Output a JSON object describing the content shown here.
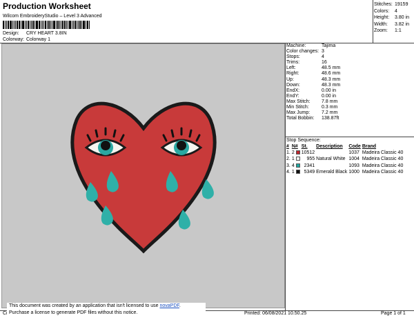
{
  "header": {
    "title": "Production Worksheet",
    "subtitle": "Wilcom EmbroideryStudio – Level 3 Advanced"
  },
  "meta": {
    "design_label": "Design:",
    "design_value": "CRY HEART 3.8IN",
    "colorway_label": "Colorway:",
    "colorway_value": "Colorway 1"
  },
  "summary": {
    "stitches_label": "Stitches:",
    "stitches_value": "19159",
    "colors_label": "Colors:",
    "colors_value": "4",
    "height_label": "Height:",
    "height_value": "3.80 in",
    "width_label": "Width:",
    "width_value": "3.82 in",
    "zoom_label": "Zoom:",
    "zoom_value": "1:1"
  },
  "specs": [
    {
      "label": "Machine:",
      "value": "Tajima"
    },
    {
      "label": "Color changes:",
      "value": "3"
    },
    {
      "label": "Stops:",
      "value": "4"
    },
    {
      "label": "Trims:",
      "value": "16"
    },
    {
      "label": "Left:",
      "value": "48.5 mm"
    },
    {
      "label": "Right:",
      "value": "48.6 mm"
    },
    {
      "label": "Up:",
      "value": "48.3 mm"
    },
    {
      "label": "Down:",
      "value": "48.3 mm"
    },
    {
      "label": "EndX:",
      "value": "0.00 in"
    },
    {
      "label": "EndY:",
      "value": "0.00 in"
    },
    {
      "label": "Max Stitch:",
      "value": "7.8 mm"
    },
    {
      "label": "Min Stitch:",
      "value": "0.3 mm"
    },
    {
      "label": "Max Jump:",
      "value": "7.2 mm"
    },
    {
      "label": "Total Bobbin:",
      "value": "138.87ft"
    }
  ],
  "stop_sequence": {
    "title": "Stop Sequence:",
    "headers": [
      "#",
      "N#",
      "St.",
      "Description",
      "Code",
      "Brand"
    ],
    "rows": [
      {
        "num": "1.",
        "n": "2",
        "color": "#c0262e",
        "st": "10512",
        "desc": "",
        "code": "1037",
        "brand": "Madeira Classic 40"
      },
      {
        "num": "2.",
        "n": "1",
        "color": "#f2f2ee",
        "st": "955",
        "desc": "Natural White",
        "code": "1004",
        "brand": "Madeira Classic 40"
      },
      {
        "num": "3.",
        "n": "4",
        "color": "#1fa7a0",
        "st": "2341",
        "desc": "",
        "code": "1093",
        "brand": "Madeira Classic 40"
      },
      {
        "num": "4.",
        "n": "1",
        "color": "#111111",
        "st": "5349",
        "desc": "Emerald Black",
        "code": "1000",
        "brand": "Madeira Classic 40"
      }
    ]
  },
  "notice": {
    "line1_prefix": "This document was created by an application that isn't licensed to use ",
    "line1_link": "novaPDF",
    "line1_suffix": ".",
    "line2": "Purchase a license to generate PDF files without this notice."
  },
  "footer": {
    "left": "Cr",
    "printed": "Printed: 06/08/2021 10.50.25",
    "page": "Page 1 of 1"
  },
  "colors": {
    "heart": "#c83a3a",
    "outline": "#1a1a1a",
    "tear": "#2fb0a8",
    "iris": "#2aa7a1",
    "eye_white": "#f5f5f0",
    "design_bg": "#c8c8c8"
  }
}
